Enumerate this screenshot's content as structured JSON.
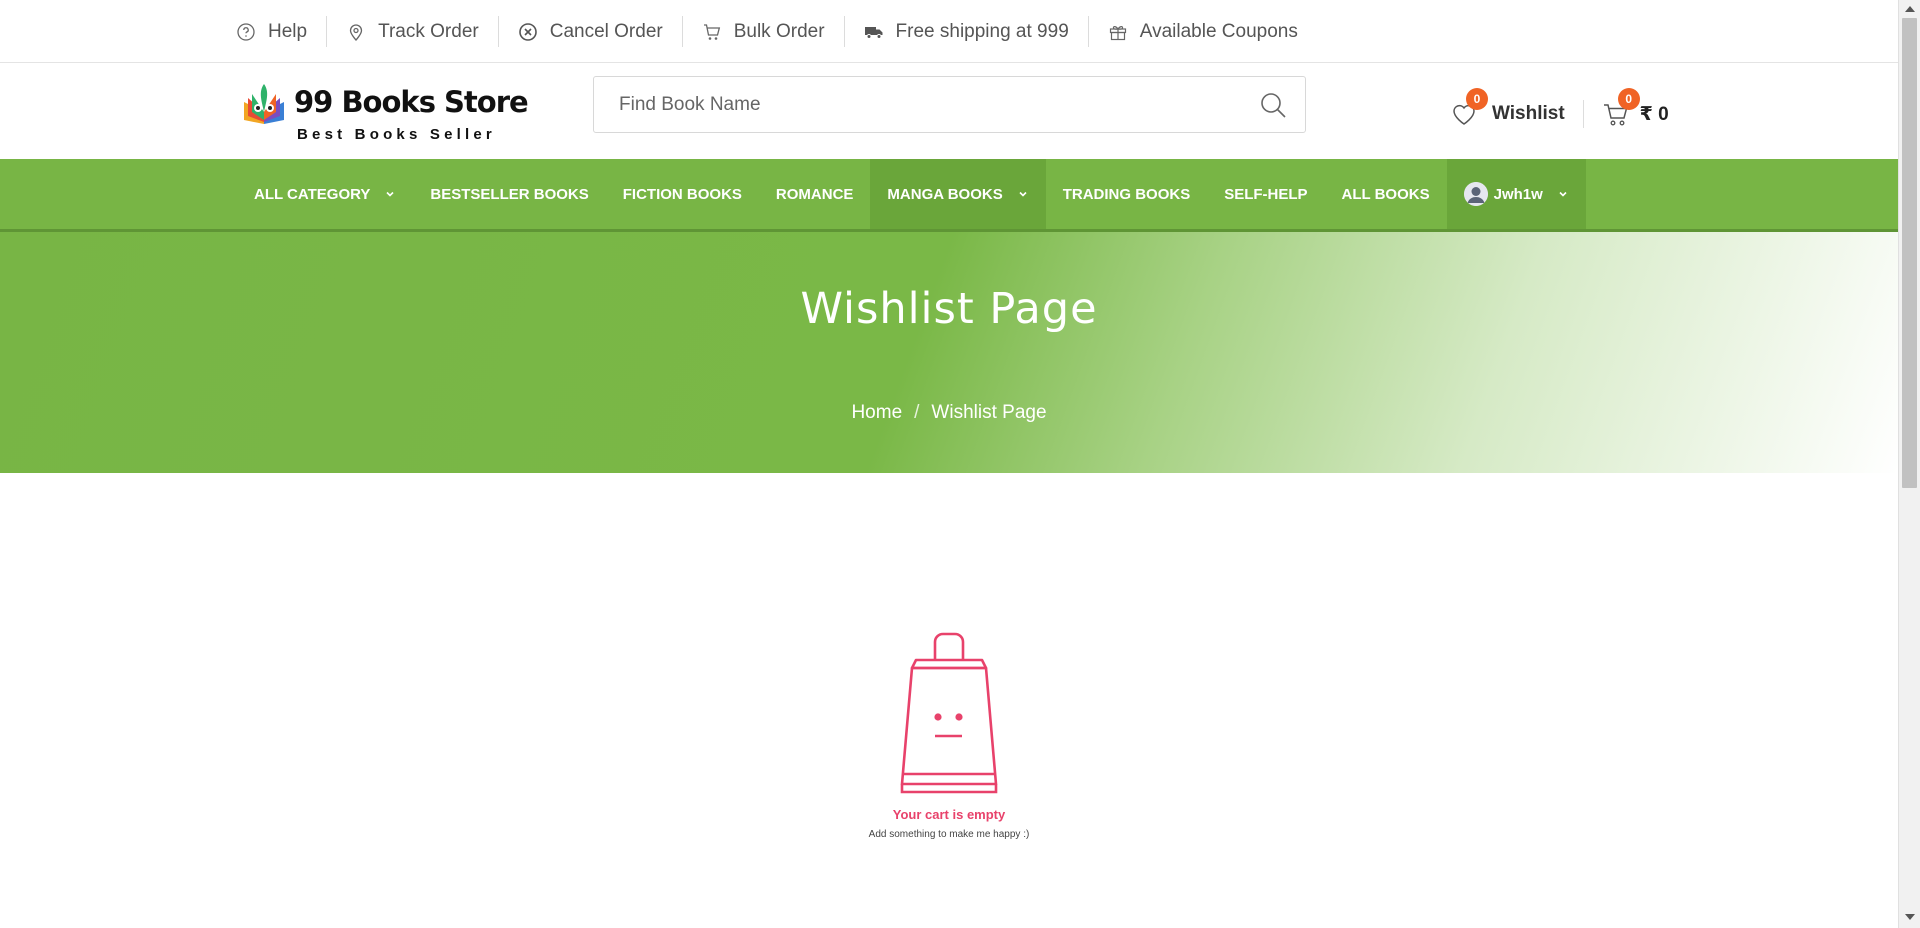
{
  "topbar": {
    "items": [
      {
        "label": "Help",
        "icon": "help-circle-icon"
      },
      {
        "label": "Track Order",
        "icon": "map-pin-icon"
      },
      {
        "label": "Cancel Order",
        "icon": "cancel-circle-icon"
      },
      {
        "label": "Bulk Order",
        "icon": "cart-icon"
      },
      {
        "label": "Free shipping at 999",
        "icon": "truck-icon"
      },
      {
        "label": "Available Coupons",
        "icon": "gift-icon"
      }
    ]
  },
  "header": {
    "logo_name": "99 Books Store",
    "logo_tagline": "Best Books Seller",
    "search_placeholder": "Find Book Name",
    "wishlist_label": "Wishlist",
    "wishlist_count": "0",
    "cart_count": "0",
    "cart_amount": "₹ 0"
  },
  "nav": {
    "items": [
      {
        "label": "All Category",
        "has_dropdown": true
      },
      {
        "label": "Bestseller Books"
      },
      {
        "label": "Fiction Books"
      },
      {
        "label": "Romance"
      },
      {
        "label": "Manga Books",
        "has_dropdown": true
      },
      {
        "label": "Trading Books"
      },
      {
        "label": "Self-Help"
      },
      {
        "label": "All Books"
      }
    ],
    "user_name": "Jwh1w"
  },
  "banner": {
    "title": "Wishlist Page",
    "breadcrumb": [
      "Home",
      "Wishlist Page"
    ],
    "separator": "/"
  },
  "empty_state": {
    "title": "Your cart is empty",
    "subtitle": "Add something to make me happy :)"
  },
  "colors": {
    "accent_green": "#78b545",
    "badge_orange": "#f06325",
    "empty_pink": "#e8426b"
  }
}
